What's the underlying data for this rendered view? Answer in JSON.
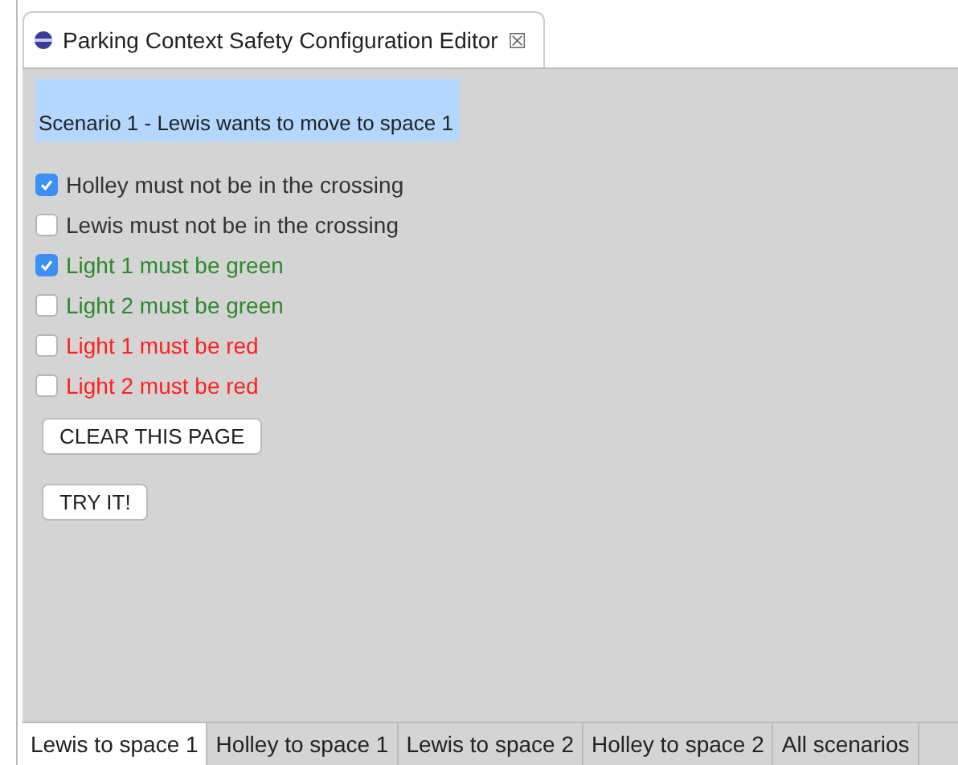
{
  "editor_tab": {
    "title": "Parking Context Safety Configuration Editor",
    "close": "☒"
  },
  "scenario_title": "Scenario 1 - Lewis wants to move to space 1",
  "conditions": [
    {
      "label": "Holley must not be in the crossing",
      "checked": true,
      "color": "#333333"
    },
    {
      "label": "Lewis must not be in the crossing",
      "checked": false,
      "color": "#333333"
    },
    {
      "label": "Light 1 must be green",
      "checked": true,
      "color": "#2a8a2a"
    },
    {
      "label": "Light 2 must be green",
      "checked": false,
      "color": "#2a8a2a"
    },
    {
      "label": "Light 1 must be red",
      "checked": false,
      "color": "#ff2020"
    },
    {
      "label": "Light 2 must be red",
      "checked": false,
      "color": "#ff2020"
    }
  ],
  "buttons": [
    "CLEAR THIS PAGE",
    "TRY IT!"
  ],
  "page_tabs": [
    {
      "label": "Lewis to space 1",
      "selected": true
    },
    {
      "label": "Holley to space 1",
      "selected": false
    },
    {
      "label": "Lewis to space 2",
      "selected": false
    },
    {
      "label": "Holley to space 2",
      "selected": false
    },
    {
      "label": "All scenarios",
      "selected": false
    }
  ]
}
